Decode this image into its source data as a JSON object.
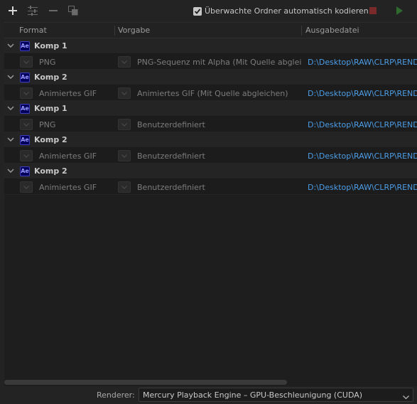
{
  "toolbar": {
    "add_icon": "plus-icon",
    "settings_icon": "sliders-icon",
    "remove_icon": "minus-icon",
    "duplicate_icon": "duplicate-icon",
    "watch_folder_label": "Überwachte Ordner automatisch kodieren",
    "watch_folder_checked": true,
    "stop_color": "#7a2a2a",
    "play_color": "#2f6a2f"
  },
  "columns": {
    "format": "Format",
    "preset": "Vorgabe",
    "output": "Ausgabedatei"
  },
  "queue": [
    {
      "comp_icon": "Ae",
      "comp": "Komp 1",
      "output": {
        "format": "PNG",
        "preset": "PNG-Sequenz mit Alpha (Mit Quelle abgleich…",
        "path": "D:\\Desktop\\RAW\\CLRP\\REND"
      }
    },
    {
      "comp_icon": "Ae",
      "comp": "Komp 2",
      "output": {
        "format": "Animiertes GIF",
        "preset": "Animiertes GIF (Mit Quelle abgleichen)",
        "path": "D:\\Desktop\\RAW\\CLRP\\REND"
      }
    },
    {
      "comp_icon": "Ae",
      "comp": "Komp 1",
      "output": {
        "format": "PNG",
        "preset": "Benutzerdefiniert",
        "path": "D:\\Desktop\\RAW\\CLRP\\REND"
      }
    },
    {
      "comp_icon": "Ae",
      "comp": "Komp 2",
      "output": {
        "format": "Animiertes GIF",
        "preset": "Benutzerdefiniert",
        "path": "D:\\Desktop\\RAW\\CLRP\\REND"
      }
    },
    {
      "comp_icon": "Ae",
      "comp": "Komp 2",
      "output": {
        "format": "Animiertes GIF",
        "preset": "Benutzerdefiniert",
        "path": "D:\\Desktop\\RAW\\CLRP\\REND"
      }
    }
  ],
  "renderer": {
    "label": "Renderer:",
    "value": "Mercury Playback Engine – GPU-Beschleunigung (CUDA)"
  },
  "colors": {
    "path_link": "#4d9de6",
    "ae_icon_bg": "#00005b",
    "ae_icon_fg": "#9999ff"
  }
}
